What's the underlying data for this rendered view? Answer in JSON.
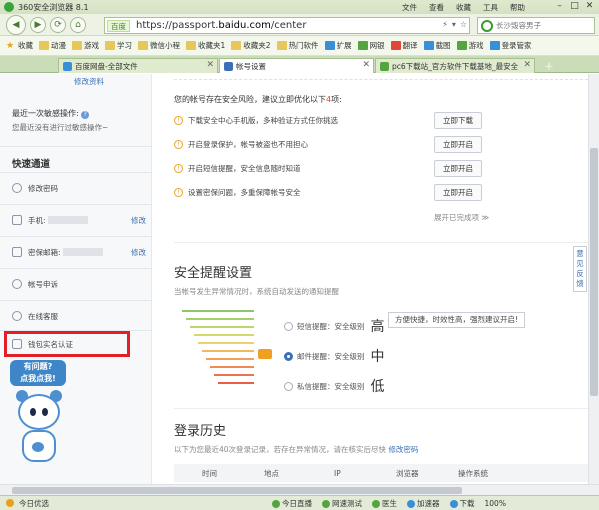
{
  "browser": {
    "title": "360安全浏览器 8.1",
    "menu": [
      "文件",
      "查看",
      "收藏",
      "工具",
      "帮助"
    ],
    "url_security": "百度",
    "url_prefix": "https://passport.",
    "url_domain": "baidu.com",
    "url_path": "/center",
    "search_placeholder": "长沙毁容男子",
    "colors": {
      "chrome_green": "#d3e2c2",
      "link_blue": "#3b6fb6",
      "warning_orange": "#f0a020",
      "highlight_red": "#e21f26"
    }
  },
  "bookmarks": [
    "收藏",
    "动漫",
    "游戏",
    "学习",
    "微信小程",
    "收藏夹1",
    "收藏夹2",
    "热门软件",
    "扩展",
    "网银",
    "翻译",
    "截图",
    "游戏",
    "登录管家"
  ],
  "tabs": [
    {
      "label": "百度网盘-全部文件",
      "active": false
    },
    {
      "label": "帐号设置",
      "active": true
    },
    {
      "label": "pc6下载站_官方软件下载基地_最安全",
      "active": false
    }
  ],
  "sidebar": {
    "profile_link": "修改资料",
    "last_op_title": "最近一次敏感操作:",
    "last_op_desc": "您最近没有进行过敏感操作~",
    "quick_title": "快速通道",
    "items": [
      {
        "label": "修改密码",
        "icon": "lock-icon",
        "action": ""
      },
      {
        "label": "手机:",
        "icon": "phone-icon",
        "action": "修改"
      },
      {
        "label": "密保邮箱:",
        "icon": "mail-icon",
        "action": "修改"
      },
      {
        "label": "帐号申诉",
        "icon": "appeal-icon",
        "action": ""
      },
      {
        "label": "在线客服",
        "icon": "help-icon",
        "action": ""
      },
      {
        "label": "钱包实名认证",
        "icon": "id-card-icon",
        "action": ""
      }
    ],
    "mascot_line1": "有问题?",
    "mascot_line2": "点我点我!"
  },
  "main": {
    "risk_title_pre": "您的帐号存在安全风险，建议立即优化以下",
    "risk_count": "4",
    "risk_title_post": "项:",
    "risks": [
      {
        "text": "下载安全中心手机版，多种验证方式任你挑选",
        "button": "立即下载"
      },
      {
        "text": "开启登录保护，帐号被盗也不用担心",
        "button": "立即开启"
      },
      {
        "text": "开启短信提醒，安全信息随时知道",
        "button": "立即开启"
      },
      {
        "text": "设置密保问题，多重保障帐号安全",
        "button": "立即开启"
      }
    ],
    "expand": "展开已完成项 ≫",
    "alert_title": "安全提醒设置",
    "alert_desc": "当帐号发生异常情况时，系统自动发送的通知提醒",
    "levels": [
      {
        "label": "短信提醒：安全级别",
        "grade": "高",
        "selected": false
      },
      {
        "label": "邮件提醒：安全级别",
        "grade": "中",
        "selected": true
      },
      {
        "label": "私信提醒：安全级别",
        "grade": "低",
        "selected": false
      }
    ],
    "tip": "方便快捷，时效性高，强烈建议开启!",
    "history_title": "登录历史",
    "history_desc": "以下为您最近40次登录记录，若存在异常情况，请在核实后尽快",
    "history_link": "修改密码",
    "history_columns": [
      "时间",
      "地点",
      "IP",
      "浏览器",
      "操作系统"
    ],
    "feedback": "意见反馈"
  },
  "statusbar": {
    "left": "今日优选",
    "items": [
      "今日直播",
      "网速测试",
      "医生",
      "加速器",
      "下载",
      "100%"
    ]
  }
}
